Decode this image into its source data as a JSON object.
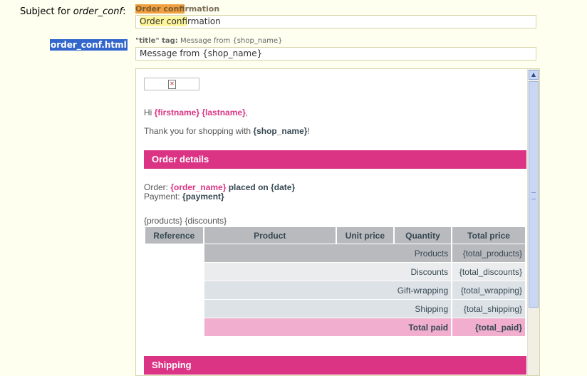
{
  "subject": {
    "label_prefix": "Subject for ",
    "label_template": "order_conf",
    "label_suffix": ":",
    "hint_highlight": "Order conf",
    "hint_rest": "irmation",
    "value_highlight": "Order conf",
    "value_rest": "irmation"
  },
  "html_template": {
    "label": "order_conf.html",
    "title_hint_tag": "\"title\" tag:",
    "title_hint_value": "Message from {shop_name}",
    "title_value": "Message from {shop_name}"
  },
  "email": {
    "greeting_hi": "Hi ",
    "firstname": "{firstname}",
    "lastname": "{lastname}",
    "greeting_end": ",",
    "thanks_prefix": "Thank you for shopping with ",
    "shop_name": "{shop_name}",
    "thanks_end": "!",
    "order_details_title": "Order details",
    "order_label": "Order: ",
    "order_name": "{order_name}",
    "placed_on": " placed on {date}",
    "payment_label": "Payment: ",
    "payment": "{payment}",
    "products_line": "{products} {discounts}",
    "shipping_title": "Shipping"
  },
  "table": {
    "headers": [
      "Reference",
      "Product",
      "Unit price",
      "Quantity",
      "Total price"
    ],
    "rows": [
      {
        "label": "Products",
        "value": "{total_products}"
      },
      {
        "label": "Discounts",
        "value": "{total_discounts}"
      },
      {
        "label": "Gift-wrapping",
        "value": "{total_wrapping}"
      },
      {
        "label": "Shipping",
        "value": "{total_shipping}"
      },
      {
        "label": "Total paid",
        "value": "{total_paid}"
      }
    ]
  },
  "icons": {
    "logo": "broken-image-icon",
    "scroll_up": "scroll-up-arrow-icon"
  },
  "colors": {
    "accent": "#db3484",
    "header_gray": "#b9babe",
    "total_pink": "#f1aecf",
    "selection": "#3366cc"
  }
}
